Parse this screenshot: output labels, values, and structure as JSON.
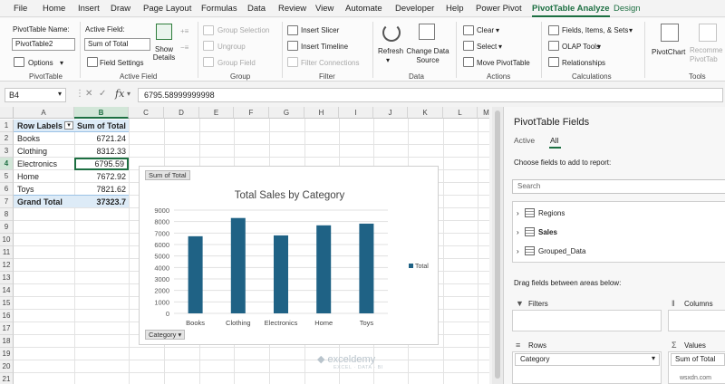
{
  "menu": [
    "File",
    "Home",
    "Insert",
    "Draw",
    "Page Layout",
    "Formulas",
    "Data",
    "Review",
    "View",
    "Automate",
    "Developer",
    "Help",
    "Power Pivot",
    "PivotTable Analyze",
    "Design"
  ],
  "ribbon": {
    "pivottable_name_label": "PivotTable Name:",
    "pivottable_name_value": "PivotTable2",
    "options_label": "Options",
    "group_pivottable": "PivotTable",
    "active_field_label": "Active Field:",
    "active_field_value": "Sum of Total",
    "field_settings": "Field Settings",
    "show_details": "Show Details",
    "group_active_field": "Active Field",
    "group_selection": "Group Selection",
    "ungroup": "Ungroup",
    "group_field": "Group Field",
    "group_group": "Group",
    "insert_slicer": "Insert Slicer",
    "insert_timeline": "Insert Timeline",
    "filter_connections": "Filter Connections",
    "group_filter": "Filter",
    "refresh": "Refresh",
    "change_data_source": "Change Data Source",
    "group_data": "Data",
    "clear": "Clear",
    "select": "Select",
    "move_pivottable": "Move PivotTable",
    "group_actions": "Actions",
    "fields_items_sets": "Fields, Items, & Sets",
    "olap_tools": "OLAP Tools",
    "relationships": "Relationships",
    "group_calculations": "Calculations",
    "pivotchart": "PivotChart",
    "recommended_pivottable": "Recomme PivotTab",
    "group_tools": "Tools"
  },
  "formula_bar": {
    "name_box": "B4",
    "fx": "fx",
    "formula": "6795.58999999998"
  },
  "columns": [
    "A",
    "B",
    "C",
    "D",
    "E",
    "F",
    "G",
    "H",
    "I",
    "J",
    "K",
    "L",
    "M"
  ],
  "rows": [
    "1",
    "2",
    "3",
    "4",
    "5",
    "6",
    "7",
    "8",
    "9",
    "10",
    "11",
    "12",
    "13",
    "14",
    "15",
    "16",
    "17",
    "18",
    "19",
    "20",
    "21"
  ],
  "pivot": {
    "header_row_labels": "Row Labels",
    "header_sum": "Sum of Total",
    "items": [
      {
        "label": "Books",
        "value": "6721.24"
      },
      {
        "label": "Clothing",
        "value": "8312.33"
      },
      {
        "label": "Electronics",
        "value": "6795.59"
      },
      {
        "label": "Home",
        "value": "7672.92"
      },
      {
        "label": "Toys",
        "value": "7821.62"
      }
    ],
    "grand_total_label": "Grand Total",
    "grand_total_value": "37323.7"
  },
  "chart_data": {
    "type": "bar",
    "title": "Total Sales by Category",
    "categories": [
      "Books",
      "Clothing",
      "Electronics",
      "Home",
      "Toys"
    ],
    "series": [
      {
        "name": "Total",
        "values": [
          6721.24,
          8312.33,
          6795.59,
          7672.92,
          7821.62
        ]
      }
    ],
    "ylim": [
      0,
      9000
    ],
    "yticks": [
      "0",
      "1000",
      "2000",
      "3000",
      "4000",
      "5000",
      "6000",
      "7000",
      "8000",
      "9000"
    ],
    "field_button_values": "Sum of Total",
    "field_button_axis": "Category",
    "legend_position": "right",
    "bar_color": "#1f6285"
  },
  "pane": {
    "title": "PivotTable Fields",
    "tab_active": "Active",
    "tab_all": "All",
    "choose_text": "Choose fields to add to report:",
    "search_placeholder": "Search",
    "tables": [
      "Regions",
      "Sales",
      "Grouped_Data"
    ],
    "drag_text": "Drag fields between areas below:",
    "filters": "Filters",
    "columns": "Columns",
    "rows_label": "Rows",
    "values_label": "Values",
    "rows_field": "Category",
    "values_field": "Sum of Total"
  },
  "watermark": {
    "brand": "exceldemy",
    "tagline": "EXCEL · DATA · BI",
    "corner": "wsxdn.com"
  }
}
